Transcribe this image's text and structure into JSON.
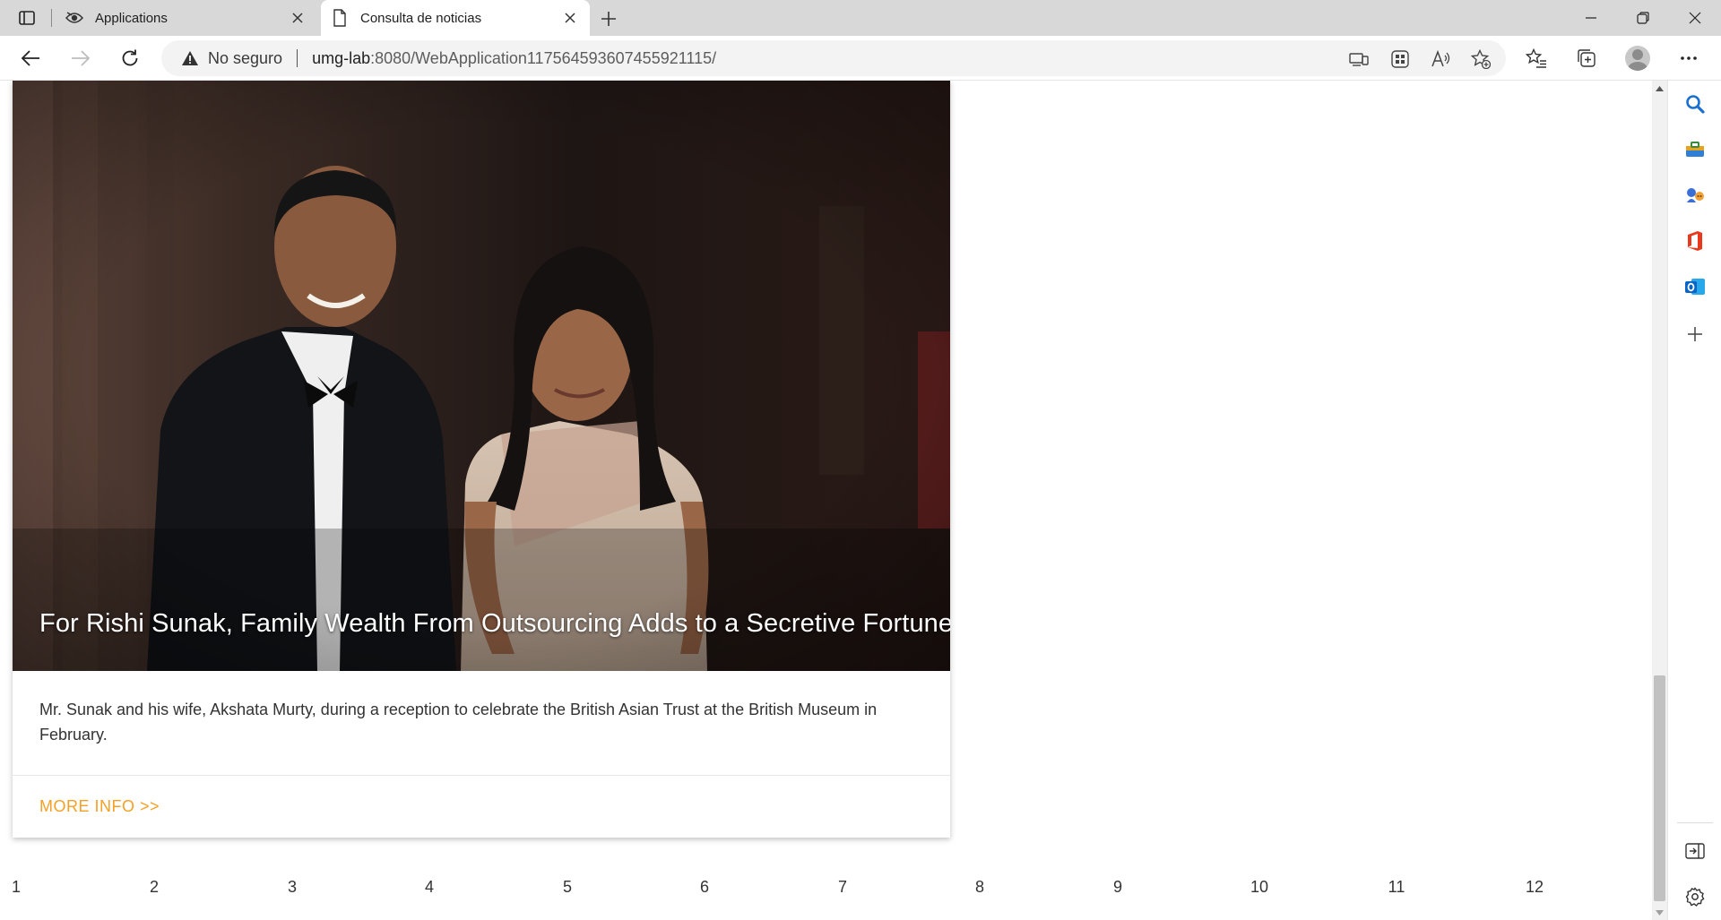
{
  "browser": {
    "tabs": [
      {
        "title": "Applications",
        "active": false
      },
      {
        "title": "Consulta de noticias",
        "active": true
      }
    ],
    "security_label": "No seguro",
    "url_host": "umg-lab",
    "url_path": ":8080/WebApplication117564593607455921115/"
  },
  "article": {
    "headline": "For Rishi Sunak, Family Wealth From Outsourcing Adds to a Secretive Fortune",
    "caption": "Mr. Sunak and his wife, Akshata Murty, during a reception to celebrate the British Asian Trust at the British Museum in February.",
    "more_info": "MORE INFO >>"
  },
  "pagination": [
    "1",
    "2",
    "3",
    "4",
    "5",
    "6",
    "7",
    "8",
    "9",
    "10",
    "11",
    "12"
  ],
  "colors": {
    "accent": "#f5a024",
    "tabstrip": "#d8d8d8",
    "omnibox": "#f3f3f3"
  },
  "icons": {
    "sidebar": [
      "search-icon",
      "tools-icon",
      "games-icon",
      "office-icon",
      "outlook-icon",
      "add-icon",
      "hide-sidebar-icon",
      "settings-icon"
    ]
  }
}
